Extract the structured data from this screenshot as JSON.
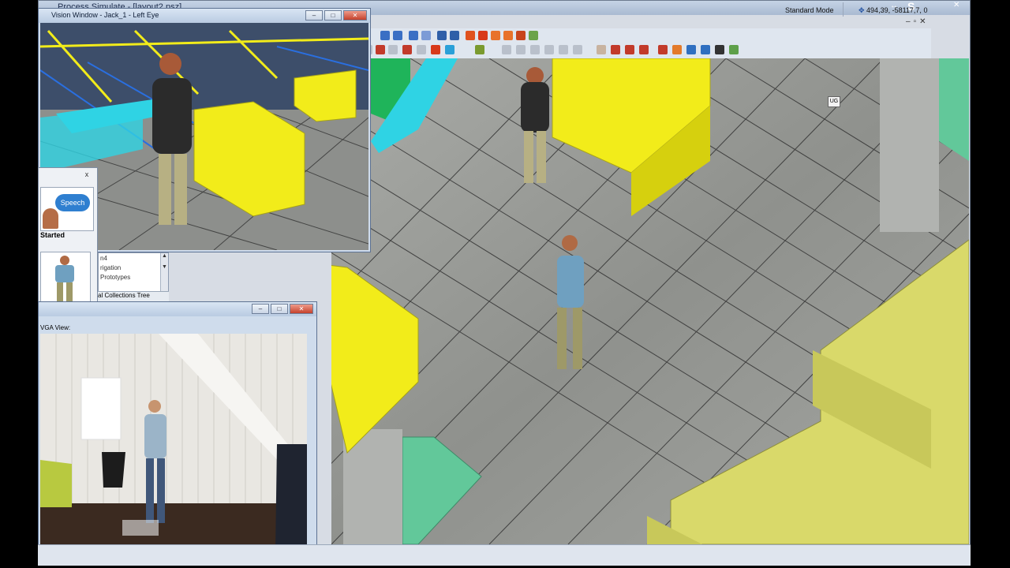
{
  "app": {
    "title": "Process Simulate - [layout2.psz]",
    "controls": {
      "minimize": "–",
      "maximize": "□",
      "close": "✕"
    },
    "mdi_controls": {
      "minimize": "–",
      "restore": "▫",
      "close": "✕"
    }
  },
  "top_right": {
    "resize_icon": "↔",
    "s_label": "S",
    "close": "✕"
  },
  "vision_window": {
    "title": "Vision Window - Jack_1 - Left Eye",
    "controls": {
      "minimize": "–",
      "maximize": "□",
      "close": "✕"
    }
  },
  "side_panel": {
    "close": "x",
    "speech_label": "Speech",
    "started_label": "Started"
  },
  "tree_panel": {
    "lines": [
      "n4",
      "rigation",
      "Prototypes"
    ],
    "tab_label": "al Collections Tree"
  },
  "vga_window": {
    "title": "",
    "label": "VGA View:",
    "controls": {
      "minimize": "–",
      "maximize": "□",
      "close": "✕"
    }
  },
  "viewport": {
    "ug_label": "UG"
  },
  "status": {
    "mode": "Standard Mode",
    "coordinates": "494,39, -58117,7, 0"
  },
  "colors": {
    "floor": "#9b9d99",
    "yellow_bin": "#f2ec1a",
    "conveyor": "#2fd3e4",
    "green_pad": "#62c89a",
    "dim_yellow": "#d9d96a"
  }
}
